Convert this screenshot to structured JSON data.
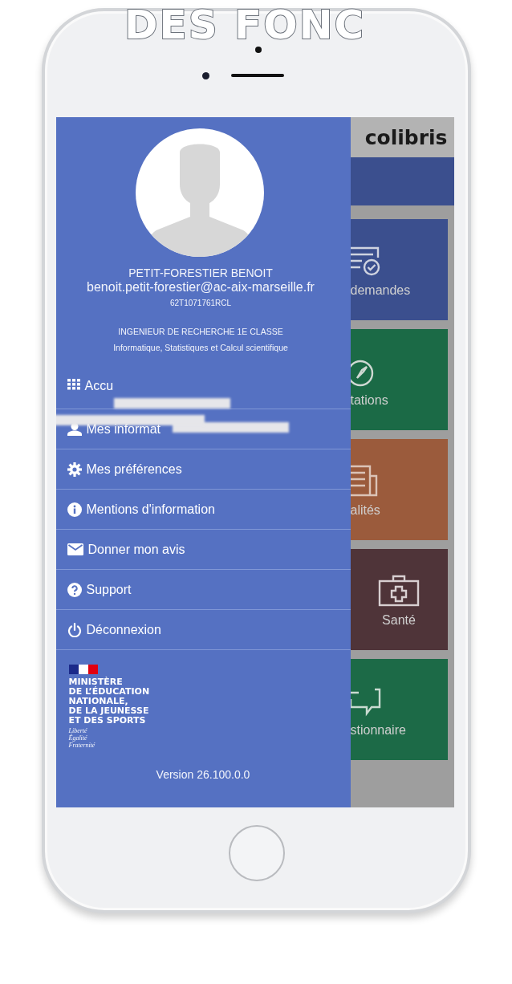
{
  "banner": {
    "text": "DES FONC"
  },
  "drawer": {
    "name": "PETIT-FORESTIER BENOIT",
    "email": "benoit.petit-forestier@ac-aix-marseille.fr",
    "id": "62T1071761RCL",
    "grade": "INGENIEUR DE RECHERCHE 1E CLASSE",
    "specialty": "Informatique, Statistiques et Calcul scientifique",
    "menu": [
      {
        "kind": "grid",
        "label": "Accu",
        "redacted": true
      },
      {
        "kind": "person",
        "label": "Mes informat",
        "redacted": true
      },
      {
        "kind": "gear",
        "label": "Mes préférences",
        "redacted": false
      },
      {
        "kind": "info",
        "label": "Mentions d'information",
        "redacted": false
      },
      {
        "kind": "mail",
        "label": "Donner mon avis",
        "redacted": false
      },
      {
        "kind": "help",
        "label": "Support",
        "redacted": false
      },
      {
        "kind": "power",
        "label": "Déconnexion",
        "redacted": false
      }
    ],
    "ministry": [
      "MINISTÈRE",
      "DE L’ÉDUCATION",
      "NATIONALE,",
      "DE LA JEUNESSE",
      "ET DES SPORTS"
    ],
    "motto": [
      "Liberté",
      "Égalité",
      "Fraternité"
    ],
    "version": "Version 26.100.0.0"
  },
  "app": {
    "title": "colibris",
    "tiles": [
      {
        "kind": "requests",
        "label": "demandes",
        "color": "#3b4f8e"
      },
      {
        "kind": "compass",
        "label": "tations",
        "color": "#1b6a46"
      },
      {
        "kind": "news",
        "label": "alités",
        "color": "#9b5b3c"
      },
      {
        "kind": "health",
        "label": "Santé",
        "color": "#4f3439"
      },
      {
        "kind": "chat",
        "label": "stionnaire",
        "color": "#1c6a47"
      }
    ]
  }
}
